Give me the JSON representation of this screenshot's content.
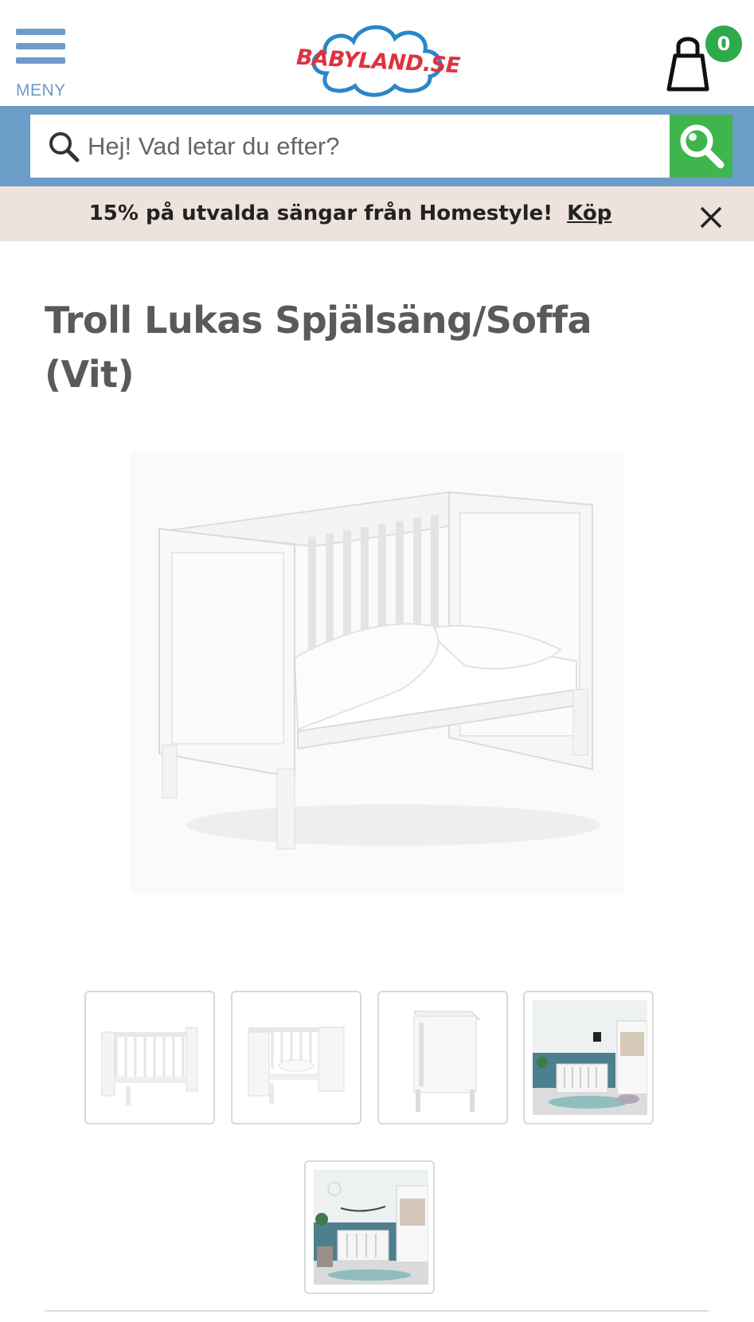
{
  "header": {
    "menu_label": "MENY",
    "logo_text": "BABYLAND.SE",
    "cart_count": "0"
  },
  "search": {
    "placeholder": "Hej! Vad letar du efter?"
  },
  "promo": {
    "text": "15% på utvalda sängar från Homestyle!",
    "link_label": "Köp"
  },
  "product": {
    "title": "Troll Lukas Spjälsäng/Soffa (Vit)",
    "thumbnails": [
      {
        "name": "crib-front-view"
      },
      {
        "name": "crib-sofa-mode"
      },
      {
        "name": "crib-end-view"
      },
      {
        "name": "room-scene-1"
      },
      {
        "name": "room-scene-2"
      }
    ]
  },
  "colors": {
    "brand_blue": "#6c9cc8",
    "search_green": "#3fb54d",
    "badge_green": "#2eaa4a",
    "promo_bg": "#ede3dc",
    "logo_red": "#e03040"
  },
  "icons": {
    "menu": "hamburger-icon",
    "cart": "shopping-bag-icon",
    "search": "magnifier-icon",
    "close": "close-icon"
  }
}
